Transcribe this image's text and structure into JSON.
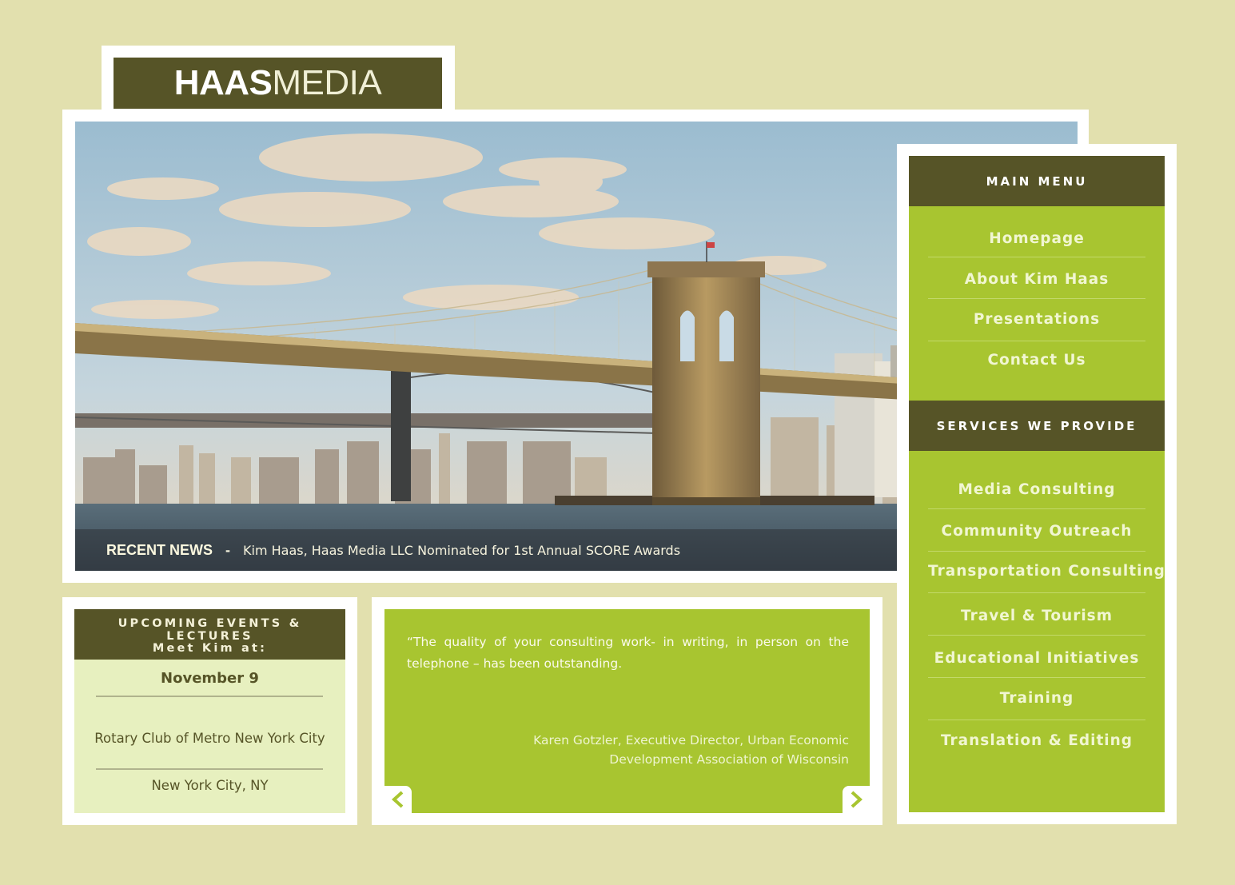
{
  "logo": {
    "bold": "HAAS",
    "light": "MEDIA"
  },
  "hero": {
    "news_label": "RECENT NEWS",
    "news_dash": "-",
    "news_text": "Kim Haas, Haas Media LLC Nominated for 1st Annual SCORE Awards"
  },
  "main_menu": {
    "heading": "MAIN MENU",
    "items": [
      "Homepage",
      "About Kim Haas",
      "Presentations",
      "Contact Us"
    ]
  },
  "services": {
    "heading": "SERVICES WE PROVIDE",
    "items": [
      "Media Consulting",
      "Community Outreach",
      "Transportation Consulting",
      "Travel & Tourism",
      "Educational Initiatives",
      "Training",
      "Translation & Editing"
    ]
  },
  "events": {
    "heading_line1": "UPCOMING EVENTS & LECTURES",
    "heading_line2": "Meet Kim at:",
    "date": "November 9",
    "venue": "Rotary Club of Metro New York City",
    "location": "New York City, NY"
  },
  "testimonial": {
    "quote": "“The quality of your consulting work- in writing, in person on the telephone – has been outstanding.",
    "author_line1": "Karen Gotzler, Executive Director, Urban Economic",
    "author_line2": "Development Association of Wisconsin",
    "prev_icon": "‹",
    "next_icon": "›"
  },
  "colors": {
    "background": "#e2e0ae",
    "olive": "#565427",
    "lime": "#a8c530",
    "pale": "#e7f0bf"
  }
}
